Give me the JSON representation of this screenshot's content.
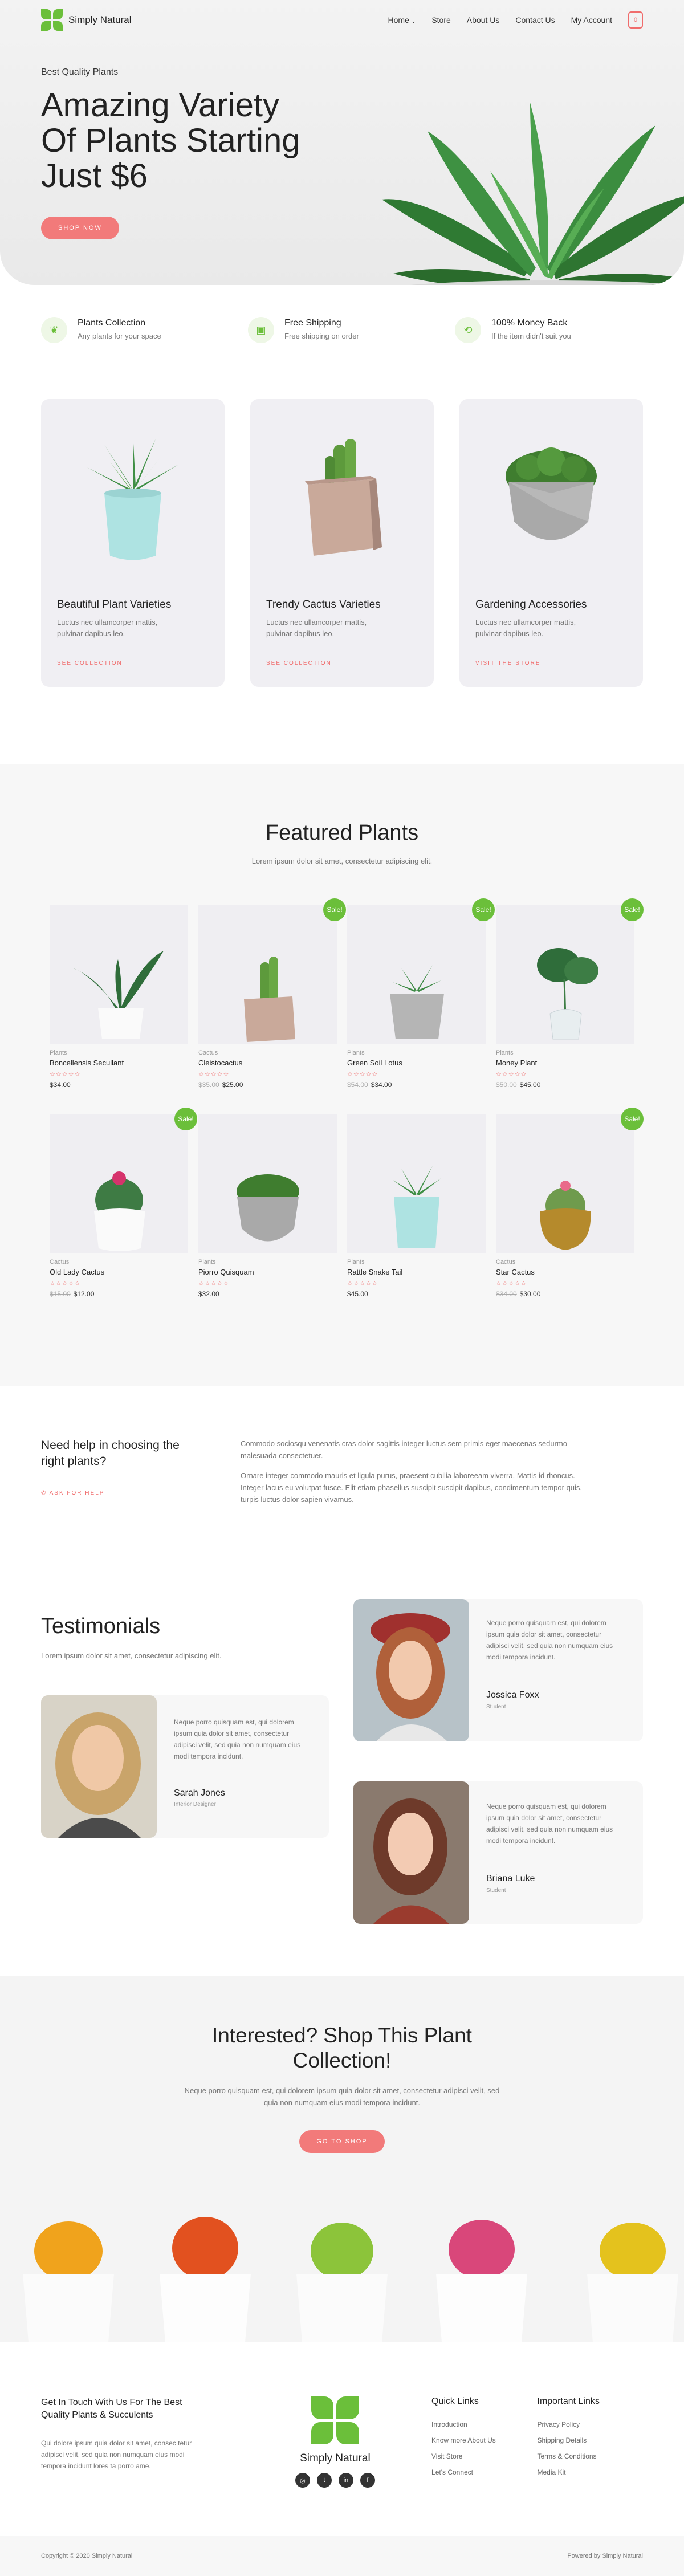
{
  "brand": {
    "name": "Simply Natural",
    "accent": "#6bbf3a",
    "coral": "#f27a7a"
  },
  "nav": {
    "items": [
      "Home",
      "Store",
      "About Us",
      "Contact Us",
      "My Account"
    ],
    "home_chevron_icon": "chevron-down-icon",
    "cart_count": "0"
  },
  "hero": {
    "eyebrow": "Best Quality Plants",
    "title_line1": "Amazing Variety",
    "title_line2": "Of Plants Starting",
    "title_line3": "Just $6",
    "button": "SHOP NOW"
  },
  "features": [
    {
      "icon": "plant-icon",
      "title": "Plants Collection",
      "sub": "Any plants for your space"
    },
    {
      "icon": "box-icon",
      "title": "Free Shipping",
      "sub": "Free shipping on order"
    },
    {
      "icon": "refresh-icon",
      "title": "100% Money Back",
      "sub": "If the item didn't suit you"
    }
  ],
  "categories": [
    {
      "title": "Beautiful Plant Varieties",
      "desc1": "Luctus nec ullamcorper mattis,",
      "desc2": "pulvinar dapibus leo.",
      "link": "SEE COLLECTION"
    },
    {
      "title": "Trendy Cactus Varieties",
      "desc1": "Luctus nec ullamcorper mattis,",
      "desc2": "pulvinar dapibus leo.",
      "link": "SEE COLLECTION"
    },
    {
      "title": "Gardening Accessories",
      "desc1": "Luctus nec ullamcorper mattis,",
      "desc2": "pulvinar dapibus leo.",
      "link": "VISIT THE STORE"
    }
  ],
  "featured": {
    "title": "Featured Plants",
    "sub": "Lorem ipsum dolor sit amet, consectetur adipiscing elit.",
    "sale_label": "Sale!",
    "products": [
      {
        "cat": "Plants",
        "name": "Boncellensis Secullant",
        "old": "",
        "price": "$34.00",
        "sale": false
      },
      {
        "cat": "Cactus",
        "name": "Cleistocactus",
        "old": "$35.00",
        "price": "$25.00",
        "sale": true
      },
      {
        "cat": "Plants",
        "name": "Green Soil Lotus",
        "old": "$54.00",
        "price": "$34.00",
        "sale": true
      },
      {
        "cat": "Plants",
        "name": "Money Plant",
        "old": "$50.00",
        "price": "$45.00",
        "sale": true
      },
      {
        "cat": "Cactus",
        "name": "Old Lady Cactus",
        "old": "$15.00",
        "price": "$12.00",
        "sale": true
      },
      {
        "cat": "Plants",
        "name": "Piorro Quisquam",
        "old": "",
        "price": "$32.00",
        "sale": false
      },
      {
        "cat": "Plants",
        "name": "Rattle Snake Tail",
        "old": "",
        "price": "$45.00",
        "sale": false
      },
      {
        "cat": "Cactus",
        "name": "Star Cactus",
        "old": "$34.00",
        "price": "$30.00",
        "sale": true
      }
    ]
  },
  "help": {
    "title_line1": "Need help in choosing the",
    "title_line2": "right plants?",
    "link": "ASK FOR HELP",
    "p1": "Commodo sociosqu venenatis cras dolor sagittis integer luctus sem primis eget maecenas sedurmo malesuada consectetuer.",
    "p2": "Ornare integer commodo mauris et ligula purus, praesent cubilia laboreeam viverra. Mattis id rhoncus. Integer lacus eu volutpat fusce. Elit etiam phasellus suscipit suscipit dapibus, condimentum tempor quis, turpis luctus dolor sapien vivamus."
  },
  "testimonials": {
    "title": "Testimonials",
    "sub": "Lorem ipsum dolor sit amet, consectetur adipiscing elit.",
    "quote": "Neque porro quisquam est, qui dolorem ipsum quia dolor sit amet, consectetur adipisci velit, sed quia non numquam eius modi tempora incidunt.",
    "items": [
      {
        "name": "Sarah Jones",
        "role": "Interior Designer"
      },
      {
        "name": "Jossica Foxx",
        "role": "Student"
      },
      {
        "name": "Briana Luke",
        "role": "Student"
      }
    ]
  },
  "cta": {
    "title_line1": "Interested? Shop This Plant",
    "title_line2": "Collection!",
    "desc1": "Neque porro quisquam est, qui dolorem ipsum quia dolor sit amet, consectetur adipisci velit, sed",
    "desc2": "quia non numquam eius modi tempora incidunt.",
    "button": "GO TO SHOP"
  },
  "footer": {
    "head1": "Get In Touch With Us For The Best",
    "head2": "Quality Plants & Succulents",
    "text": "Qui dolore ipsum quia dolor sit amet, consec tetur adipisci velit, sed quia non numquam eius modi tempora incidunt lores ta porro ame.",
    "brand": "Simply Natural",
    "socials": [
      "instagram-icon",
      "twitter-icon",
      "linkedin-icon",
      "facebook-icon"
    ],
    "social_glyphs": [
      "◎",
      "t",
      "in",
      "f"
    ],
    "quick_title": "Quick Links",
    "quick": [
      "Introduction",
      "Know more About Us",
      "Visit Store",
      "Let's Connect"
    ],
    "important_title": "Important Links",
    "important": [
      "Privacy Policy",
      "Shipping Details",
      "Terms & Conditions",
      "Media Kit"
    ],
    "copyright": "Copyright © 2020 Simply Natural",
    "powered": "Powered by Simply Natural"
  }
}
